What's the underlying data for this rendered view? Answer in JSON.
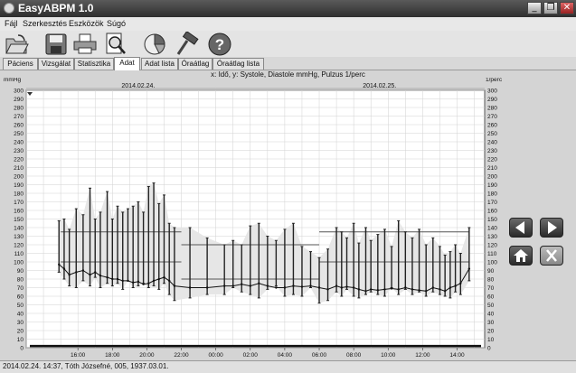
{
  "window": {
    "title": "EasyABPM 1.0",
    "minimize_label": "_",
    "maximize_label": "❐",
    "close_label": "✕"
  },
  "menu": {
    "items": [
      {
        "label": "Fájl"
      },
      {
        "label": "Szerkesztés"
      },
      {
        "label": "Eszközök"
      },
      {
        "label": "Súgó"
      }
    ]
  },
  "toolbar": {
    "icons": [
      "open-folder-icon",
      "save-disk-icon",
      "printer-icon",
      "print-preview-icon",
      "pie-chart-icon",
      "hammer-icon",
      "help-icon"
    ]
  },
  "tabs": [
    {
      "label": "Páciens",
      "active": false
    },
    {
      "label": "Vizsgálat",
      "active": false
    },
    {
      "label": "Statisztika",
      "active": false
    },
    {
      "label": "Adat",
      "active": true
    },
    {
      "label": "Adat lista",
      "active": false
    },
    {
      "label": "Óraátlag",
      "active": false
    },
    {
      "label": "Óraátlag lista",
      "active": false
    }
  ],
  "chart_caption": "x: Idő,  y: Systole, Diastole mmHg, Pulzus 1/perc",
  "nav_buttons": [
    "prev-arrow-icon",
    "next-arrow-icon",
    "home-icon",
    "close-x-icon"
  ],
  "status": {
    "text": "2014.02.24. 14:37, Tóth Józsefné, 005, 1937.03.01."
  },
  "chart_data": {
    "type": "line",
    "ylabel_left": "mmHg",
    "ylabel_right": "1/perc",
    "ylim": [
      0,
      300
    ],
    "ytick_step": 10,
    "grid": true,
    "date_labels": [
      {
        "label": "2014.02.24.",
        "hour": 19.5
      },
      {
        "label": "2014.02.25.",
        "hour": 33.5
      }
    ],
    "x_ticks": [
      "16:00",
      "18:00",
      "20:00",
      "22:00",
      "00:00",
      "02:00",
      "04:00",
      "06:00",
      "08:00",
      "10:00",
      "12:00",
      "14:00"
    ],
    "reference_lines": [
      {
        "name": "day systolic limit",
        "from_hour": 15.0,
        "to_hour": 22.0,
        "value": 135
      },
      {
        "name": "night systolic limit",
        "from_hour": 22.0,
        "to_hour": 30.0,
        "value": 120
      },
      {
        "name": "day systolic limit 2",
        "from_hour": 30.0,
        "to_hour": 38.7,
        "value": 135
      },
      {
        "name": "day diastolic limit",
        "from_hour": 15.0,
        "to_hour": 22.0,
        "value": 100
      },
      {
        "name": "night diastolic limit",
        "from_hour": 22.0,
        "to_hour": 30.0,
        "value": 80
      },
      {
        "name": "day diastolic limit 2",
        "from_hour": 30.0,
        "to_hour": 38.7,
        "value": 100
      }
    ],
    "measurements": [
      {
        "hour": 14.9,
        "sys": 148,
        "dia": 88,
        "pulse": 97
      },
      {
        "hour": 15.2,
        "sys": 150,
        "dia": 80,
        "pulse": 92
      },
      {
        "hour": 15.5,
        "sys": 138,
        "dia": 72,
        "pulse": 85
      },
      {
        "hour": 15.9,
        "sys": 162,
        "dia": 70,
        "pulse": 88
      },
      {
        "hour": 16.3,
        "sys": 155,
        "dia": 78,
        "pulse": 90
      },
      {
        "hour": 16.7,
        "sys": 186,
        "dia": 72,
        "pulse": 85
      },
      {
        "hour": 17.0,
        "sys": 150,
        "dia": 82,
        "pulse": 88
      },
      {
        "hour": 17.3,
        "sys": 158,
        "dia": 70,
        "pulse": 84
      },
      {
        "hour": 17.7,
        "sys": 182,
        "dia": 75,
        "pulse": 82
      },
      {
        "hour": 18.0,
        "sys": 150,
        "dia": 72,
        "pulse": 80
      },
      {
        "hour": 18.3,
        "sys": 165,
        "dia": 75,
        "pulse": 80
      },
      {
        "hour": 18.6,
        "sys": 158,
        "dia": 68,
        "pulse": 78
      },
      {
        "hour": 18.9,
        "sys": 162,
        "dia": 78,
        "pulse": 78
      },
      {
        "hour": 19.2,
        "sys": 165,
        "dia": 70,
        "pulse": 76
      },
      {
        "hour": 19.5,
        "sys": 170,
        "dia": 72,
        "pulse": 77
      },
      {
        "hour": 19.8,
        "sys": 158,
        "dia": 75,
        "pulse": 74
      },
      {
        "hour": 20.1,
        "sys": 188,
        "dia": 70,
        "pulse": 75
      },
      {
        "hour": 20.4,
        "sys": 192,
        "dia": 72,
        "pulse": 78
      },
      {
        "hour": 20.7,
        "sys": 168,
        "dia": 68,
        "pulse": 80
      },
      {
        "hour": 21.0,
        "sys": 178,
        "dia": 75,
        "pulse": 82
      },
      {
        "hour": 21.3,
        "sys": 145,
        "dia": 62,
        "pulse": 78
      },
      {
        "hour": 21.6,
        "sys": 140,
        "dia": 55,
        "pulse": 72
      },
      {
        "hour": 22.5,
        "sys": 140,
        "dia": 58,
        "pulse": 70
      },
      {
        "hour": 23.5,
        "sys": 128,
        "dia": 62,
        "pulse": 70
      },
      {
        "hour": 24.5,
        "sys": 120,
        "dia": 62,
        "pulse": 72
      },
      {
        "hour": 25.0,
        "sys": 125,
        "dia": 70,
        "pulse": 72
      },
      {
        "hour": 25.5,
        "sys": 120,
        "dia": 65,
        "pulse": 74
      },
      {
        "hour": 26.0,
        "sys": 142,
        "dia": 62,
        "pulse": 72
      },
      {
        "hour": 26.5,
        "sys": 145,
        "dia": 58,
        "pulse": 75
      },
      {
        "hour": 27.0,
        "sys": 130,
        "dia": 68,
        "pulse": 72
      },
      {
        "hour": 27.5,
        "sys": 125,
        "dia": 72,
        "pulse": 70
      },
      {
        "hour": 28.0,
        "sys": 138,
        "dia": 60,
        "pulse": 70
      },
      {
        "hour": 28.5,
        "sys": 145,
        "dia": 62,
        "pulse": 72
      },
      {
        "hour": 29.0,
        "sys": 118,
        "dia": 60,
        "pulse": 71
      },
      {
        "hour": 29.5,
        "sys": 112,
        "dia": 70,
        "pulse": 72
      },
      {
        "hour": 30.0,
        "sys": 105,
        "dia": 52,
        "pulse": 70
      },
      {
        "hour": 30.5,
        "sys": 115,
        "dia": 55,
        "pulse": 68
      },
      {
        "hour": 31.0,
        "sys": 140,
        "dia": 65,
        "pulse": 72
      },
      {
        "hour": 31.3,
        "sys": 135,
        "dia": 60,
        "pulse": 70
      },
      {
        "hour": 31.6,
        "sys": 128,
        "dia": 68,
        "pulse": 71
      },
      {
        "hour": 32.0,
        "sys": 145,
        "dia": 60,
        "pulse": 70
      },
      {
        "hour": 32.3,
        "sys": 122,
        "dia": 58,
        "pulse": 68
      },
      {
        "hour": 32.7,
        "sys": 140,
        "dia": 62,
        "pulse": 66
      },
      {
        "hour": 33.0,
        "sys": 125,
        "dia": 65,
        "pulse": 68
      },
      {
        "hour": 33.4,
        "sys": 132,
        "dia": 62,
        "pulse": 67
      },
      {
        "hour": 33.8,
        "sys": 138,
        "dia": 60,
        "pulse": 68
      },
      {
        "hour": 34.2,
        "sys": 118,
        "dia": 70,
        "pulse": 69
      },
      {
        "hour": 34.6,
        "sys": 148,
        "dia": 62,
        "pulse": 68
      },
      {
        "hour": 35.0,
        "sys": 135,
        "dia": 68,
        "pulse": 70
      },
      {
        "hour": 35.4,
        "sys": 128,
        "dia": 62,
        "pulse": 68
      },
      {
        "hour": 35.8,
        "sys": 138,
        "dia": 65,
        "pulse": 67
      },
      {
        "hour": 36.2,
        "sys": 120,
        "dia": 60,
        "pulse": 66
      },
      {
        "hour": 36.6,
        "sys": 128,
        "dia": 65,
        "pulse": 70
      },
      {
        "hour": 37.0,
        "sys": 118,
        "dia": 62,
        "pulse": 68
      },
      {
        "hour": 37.3,
        "sys": 108,
        "dia": 60,
        "pulse": 66
      },
      {
        "hour": 37.6,
        "sys": 112,
        "dia": 58,
        "pulse": 70
      },
      {
        "hour": 37.9,
        "sys": 120,
        "dia": 65,
        "pulse": 72
      },
      {
        "hour": 38.2,
        "sys": 110,
        "dia": 62,
        "pulse": 75
      },
      {
        "hour": 38.7,
        "sys": 140,
        "dia": 78,
        "pulse": 92
      }
    ],
    "colors": {
      "measure": "#222222",
      "pulse": "#111111",
      "band": "#e6e6e6",
      "reference": "#555555",
      "grid": "#d2d2d2"
    }
  }
}
